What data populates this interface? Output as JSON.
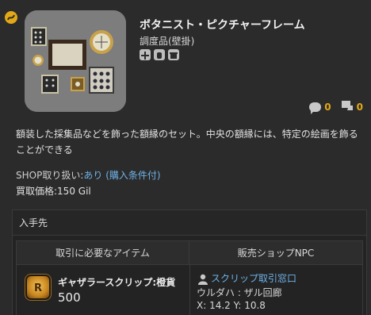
{
  "item": {
    "name": "ボタニスト・ピクチャーフレーム",
    "category": "調度品(壁掛)",
    "flag_icons": [
      "pin-icon",
      "hand-icon",
      "market-icon"
    ]
  },
  "counters": {
    "comments": "0",
    "likes": "0"
  },
  "description": "額装した採集品などを飾った額縁のセット。中央の額縁には、特定の絵画を飾ることができる",
  "shop": {
    "label": "SHOP取り扱い:",
    "value": "あり (購入条件付)",
    "price_label": "買取価格:",
    "price_value": "150 Gil"
  },
  "acquisition": {
    "header": "入手先",
    "col_item": "取引に必要なアイテム",
    "col_npc": "販売ショップNPC",
    "currency_name": "ギャザラースクリップ:橙貨",
    "currency_qty": "500",
    "npc_name": "スクリップ取引窓口",
    "npc_location": "ウルダハ : ザル回廊",
    "npc_coords": "X: 14.2 Y: 10.8"
  },
  "colors": {
    "accent_gold": "#e3a816",
    "link_blue": "#6fb2e8"
  }
}
